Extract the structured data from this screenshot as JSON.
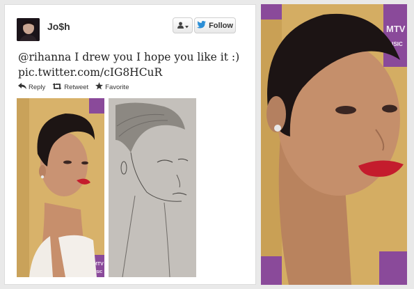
{
  "tweet": {
    "display_name": "Jo$h",
    "follow_label": "Follow",
    "text_line1": "@rihanna I drew you I hope you like it :)",
    "text_line2": "pic.twitter.com/cIG8HCuR",
    "actions": {
      "reply": "Reply",
      "retweet": "Retweet",
      "favorite": "Favorite"
    }
  },
  "photo_text": {
    "mtv": "MTV",
    "music": "MUSIC"
  },
  "colors": {
    "twitter_blue": "#2b8ed6",
    "mtv_purple": "#8a4a9a",
    "lipstick": "#c41c2d",
    "background": "#e9e9e9"
  },
  "icons": [
    "user-icon",
    "chevron-down-icon",
    "twitter-bird-icon",
    "reply-icon",
    "retweet-icon",
    "star-icon"
  ]
}
